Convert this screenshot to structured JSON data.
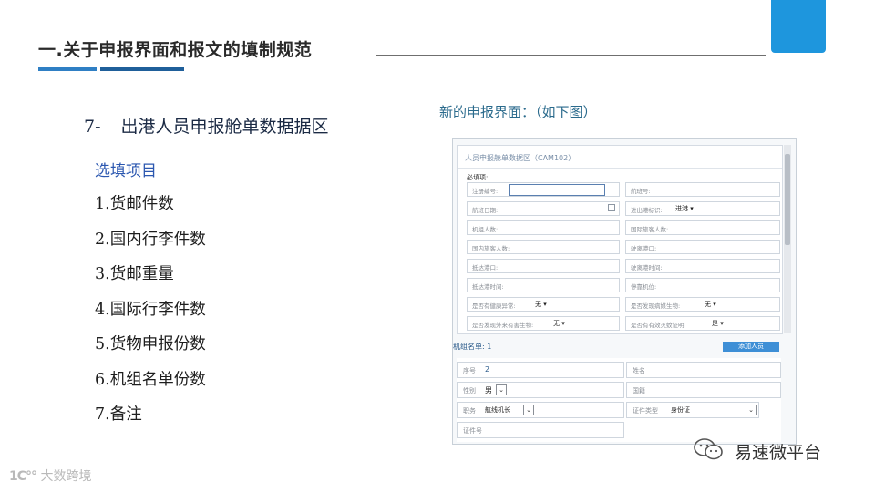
{
  "header": {
    "title": "一.关于申报界面和报文的填制规范"
  },
  "section": {
    "number": "7-",
    "title": "出港人员申报舱单数据据区"
  },
  "optional": {
    "title": "选填项目",
    "items": [
      "1.货邮件数",
      "2.国内行李件数",
      "3.货邮重量",
      "4.国际行李件数",
      "5.货物申报份数",
      "6.机组名单份数",
      "7.备注"
    ]
  },
  "new_ui_label": "新的申报界面：（如下图）",
  "screenshot": {
    "panel_title": "人员申报舱单数据区（CAM102）",
    "required_label": "必填项:",
    "fields": [
      {
        "label": "注册编号:",
        "value": ""
      },
      {
        "label": "航班号:",
        "value": ""
      },
      {
        "label": "航班日期:",
        "value": ""
      },
      {
        "label": "进出港标识:",
        "value": "进港 ▾"
      },
      {
        "label": "机组人数:",
        "value": ""
      },
      {
        "label": "国际旅客人数:",
        "value": ""
      },
      {
        "label": "国内旅客人数:",
        "value": ""
      },
      {
        "label": "驶离港口:",
        "value": ""
      },
      {
        "label": "抵达港口:",
        "value": ""
      },
      {
        "label": "驶离港时间:",
        "value": ""
      },
      {
        "label": "抵达港时间:",
        "value": ""
      },
      {
        "label": "停靠机位:",
        "value": ""
      },
      {
        "label": "是否有健康异常:",
        "value": "无 ▾"
      },
      {
        "label": "是否发现病媒生物:",
        "value": "无 ▾"
      },
      {
        "label": "是否发现外来有害生物:",
        "value": "无 ▾"
      },
      {
        "label": "是否有有效灭蚊证明:",
        "value": "是 ▾"
      }
    ],
    "crew_label": "机组名单: 1",
    "add_button": "添加人员",
    "crew": {
      "seq_label": "序号",
      "seq_value": "2",
      "name_label": "姓名",
      "gender_label": "性别",
      "gender_value": "男",
      "nationality_label": "国籍",
      "duty_label": "职务",
      "duty_value": "航线机长",
      "id_type_label": "证件类型",
      "id_type_value": "身份证",
      "id_no_label": "证件号"
    }
  },
  "footer": {
    "wechat_text": "易速微平台",
    "logo_text": "大数跨境"
  },
  "colors": {
    "accent_blue": "#1e96dd",
    "title_underline": "#2f7fc4",
    "option_title": "#2b57b0"
  }
}
